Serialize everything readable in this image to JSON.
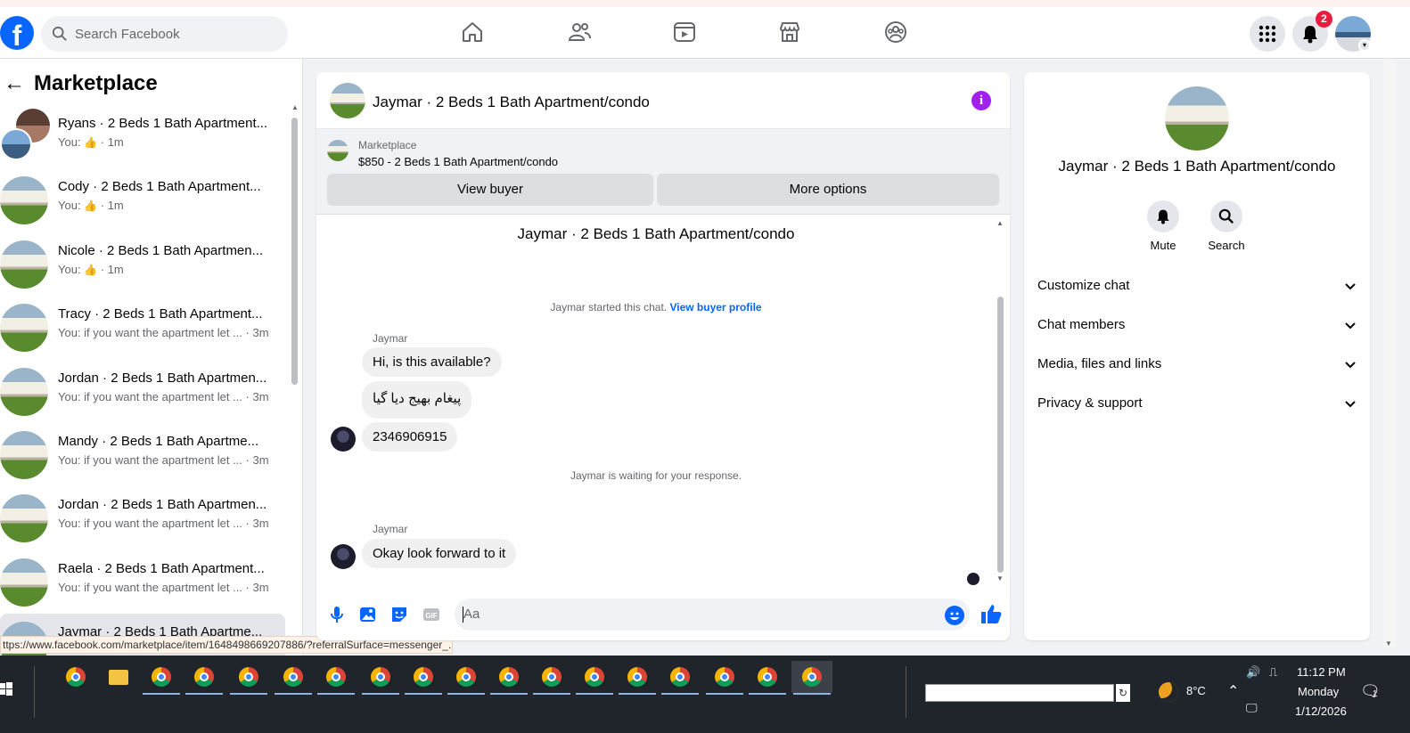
{
  "topbar": {
    "logo_letter": "f",
    "search_placeholder": "Search Facebook",
    "notification_count": "2"
  },
  "sidebar": {
    "back_arrow": "←",
    "title": "Marketplace",
    "items": [
      {
        "name": "Ryans · 2 Beds 1 Bath Apartment...",
        "sub_prefix": "You:",
        "sub_text": "",
        "time": "· 1m",
        "like": true
      },
      {
        "name": "Cody · 2 Beds 1 Bath Apartment...",
        "sub_prefix": "You:",
        "sub_text": "",
        "time": "· 1m",
        "like": true
      },
      {
        "name": "Nicole · 2 Beds 1 Bath Apartmen...",
        "sub_prefix": "You:",
        "sub_text": "",
        "time": "· 1m",
        "like": true
      },
      {
        "name": "Tracy · 2 Beds 1 Bath Apartment...",
        "sub_prefix": "You: if you want the apartment let ...",
        "sub_text": "",
        "time": "· 3m",
        "like": false
      },
      {
        "name": "Jordan · 2 Beds 1 Bath Apartmen...",
        "sub_prefix": "You: if you want the apartment let ...",
        "sub_text": "",
        "time": "· 3m",
        "like": false
      },
      {
        "name": "Mandy · 2 Beds 1 Bath Apartme...",
        "sub_prefix": "You: if you want the apartment let ...",
        "sub_text": "",
        "time": "· 3m",
        "like": false
      },
      {
        "name": "Jordan · 2 Beds 1 Bath Apartmen...",
        "sub_prefix": "You: if you want the apartment let ...",
        "sub_text": "",
        "time": "· 3m",
        "like": false
      },
      {
        "name": "Raela · 2 Beds 1 Bath Apartment...",
        "sub_prefix": "You: if you want the apartment let ...",
        "sub_text": "",
        "time": "· 3m",
        "like": false
      },
      {
        "name": "Jaymar · 2 Beds 1 Bath Apartme...",
        "sub_prefix": "",
        "sub_text": "",
        "time": "",
        "like": false
      }
    ]
  },
  "status_url": "ttps://www.facebook.com/marketplace/item/1648498669207886/?referralSurface=messenger_...",
  "chat": {
    "title": "Jaymar · 2 Beds 1 Bath Apartment/condo",
    "info_letter": "i",
    "marketplace_label": "Marketplace",
    "listing": "$850 - 2 Beds 1 Bath Apartment/condo",
    "view_buyer": "View buyer",
    "more_options": "More options",
    "body_title": "Jaymar · 2 Beds 1 Bath Apartment/condo",
    "started_text": "Jaymar started this chat.",
    "view_buyer_profile": "View buyer profile",
    "sender1": "Jaymar",
    "msg1": "Hi, is this available?",
    "msg2": "پیغام بھیج دیا گیا",
    "msg3": "2346906915",
    "waiting_text": "Jaymar is waiting for your response.",
    "sender2": "Jaymar",
    "msg4": "Okay look forward to it",
    "composer_placeholder": "Aa"
  },
  "right_panel": {
    "title": "Jaymar · 2 Beds 1 Bath Apartment/condo",
    "mute": "Mute",
    "search": "Search",
    "rows": [
      "Customize chat",
      "Chat members",
      "Media, files and links",
      "Privacy & support"
    ]
  },
  "taskbar": {
    "weather": "8°C",
    "time": "11:12 PM",
    "day": "Monday",
    "date": "1/12/2026",
    "notification_count": "1"
  },
  "colors": {
    "brand": "#0866ff",
    "info": "#a020f0",
    "badge": "#e41e3f"
  }
}
